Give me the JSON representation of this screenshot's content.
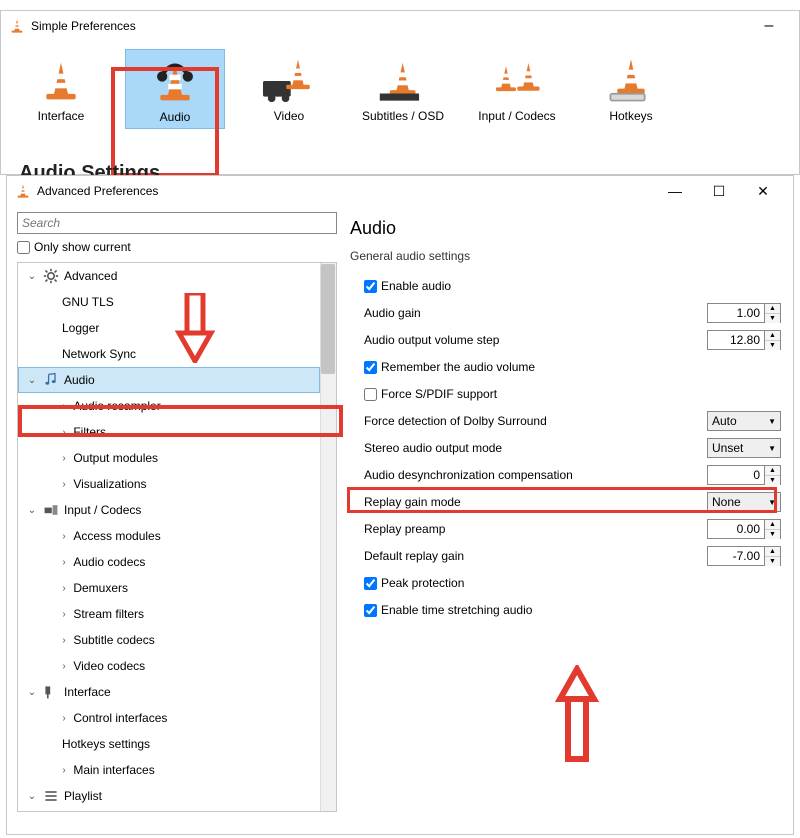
{
  "simple": {
    "title": "Simple Preferences",
    "categories": [
      {
        "label": "Interface"
      },
      {
        "label": "Audio"
      },
      {
        "label": "Video"
      },
      {
        "label": "Subtitles / OSD"
      },
      {
        "label": "Input / Codecs"
      },
      {
        "label": "Hotkeys"
      }
    ]
  },
  "advanced": {
    "title": "Advanced Preferences",
    "search_placeholder": "Search",
    "only_current": "Only show current",
    "tree": {
      "advanced": {
        "label": "Advanced",
        "children": [
          "GNU TLS",
          "Logger",
          "Network Sync"
        ]
      },
      "audio": {
        "label": "Audio",
        "children": [
          "Audio resampler",
          "Filters",
          "Output modules",
          "Visualizations"
        ]
      },
      "input": {
        "label": "Input / Codecs",
        "children": [
          "Access modules",
          "Audio codecs",
          "Demuxers",
          "Stream filters",
          "Subtitle codecs",
          "Video codecs"
        ]
      },
      "interface": {
        "label": "Interface",
        "children": [
          "Control interfaces",
          "Hotkeys settings",
          "Main interfaces"
        ]
      },
      "playlist": {
        "label": "Playlist"
      }
    },
    "content": {
      "heading": "Audio",
      "subheading": "General audio settings",
      "enable_audio": "Enable audio",
      "gain_label": "Audio gain",
      "gain_value": "1.00",
      "step_label": "Audio output volume step",
      "step_value": "12.80",
      "remember": "Remember the audio volume",
      "spdif": "Force S/PDIF support",
      "dolby_label": "Force detection of Dolby Surround",
      "dolby_value": "Auto",
      "stereo_label": "Stereo audio output mode",
      "stereo_value": "Unset",
      "desync_label": "Audio desynchronization compensation",
      "desync_value": "0",
      "rg_mode_label": "Replay gain mode",
      "rg_mode_value": "None",
      "rg_preamp_label": "Replay preamp",
      "rg_preamp_value": "0.00",
      "rg_default_label": "Default replay gain",
      "rg_default_value": "-7.00",
      "peak": "Peak protection",
      "stretch": "Enable time stretching audio"
    }
  }
}
